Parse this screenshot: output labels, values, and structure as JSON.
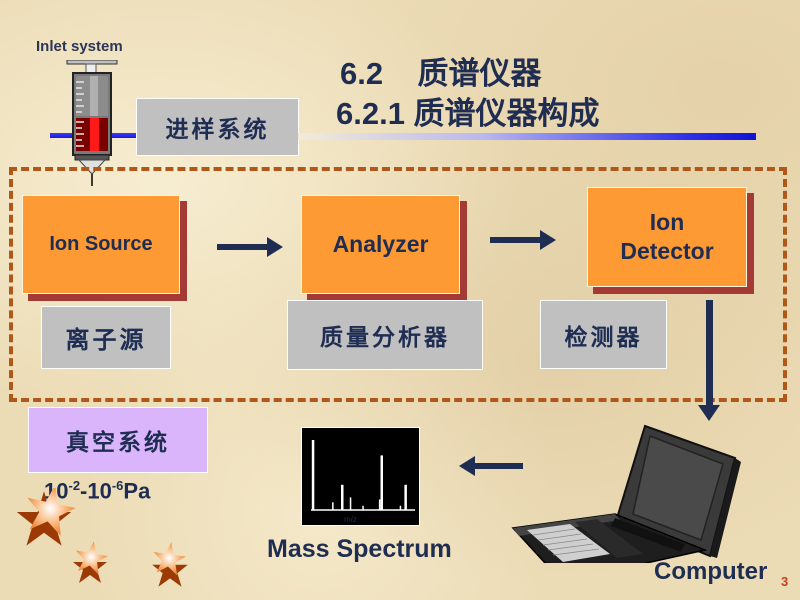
{
  "header": {
    "title_line1": "6.2    质谱仪器",
    "title_line2": "6.2.1 质谱仪器构成"
  },
  "inlet": {
    "label_en": "Inlet system",
    "label_cn": "进样系统",
    "icon": "syringe-icon"
  },
  "stages": [
    {
      "label_en": "Ion Source",
      "label_cn": "离子源"
    },
    {
      "label_en": "Analyzer",
      "label_cn": "质量分析器"
    },
    {
      "label_en_line1": "Ion",
      "label_en_line2": "Detector",
      "label_cn": "检测器"
    }
  ],
  "vacuum": {
    "label_cn": "真空系统",
    "pressure_base1": "10",
    "pressure_exp1": "-2",
    "pressure_sep": "-10",
    "pressure_exp2": "-6",
    "pressure_unit": "Pa"
  },
  "spectrum": {
    "label": "Mass Spectrum",
    "axis_label": "m/z",
    "peaks": [
      {
        "mz": 0.02,
        "intensity": 1.0
      },
      {
        "mz": 0.21,
        "intensity": 0.11
      },
      {
        "mz": 0.3,
        "intensity": 0.36
      },
      {
        "mz": 0.38,
        "intensity": 0.18
      },
      {
        "mz": 0.5,
        "intensity": 0.06
      },
      {
        "mz": 0.66,
        "intensity": 0.15
      },
      {
        "mz": 0.68,
        "intensity": 0.78
      },
      {
        "mz": 0.86,
        "intensity": 0.06
      },
      {
        "mz": 0.91,
        "intensity": 0.36
      }
    ]
  },
  "computer": {
    "label": "Computer",
    "icon": "laptop-icon"
  },
  "page_number": "3",
  "colors": {
    "stage_fill": "#fd9a33",
    "stage_shadow": "#a33a35",
    "cn_label_fill": "#c0c0c0",
    "vacuum_fill": "#dbb5fb",
    "text_navy": "#1f2d52",
    "frame_dash": "#b0581a"
  }
}
